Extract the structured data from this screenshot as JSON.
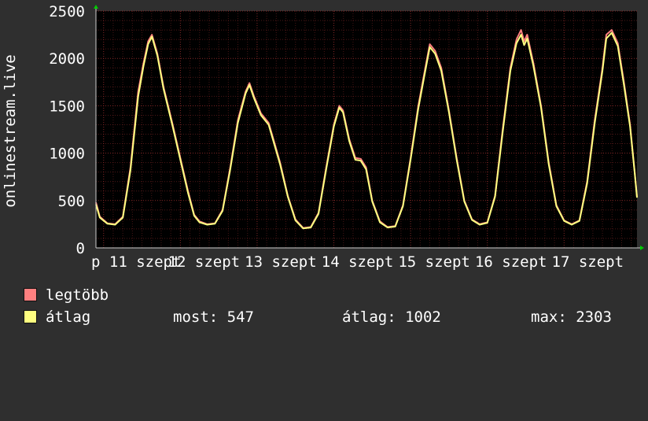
{
  "colors": {
    "background": "#2f2f2f",
    "plot_background": "#000000",
    "grid": "#8b2a2a",
    "text": "#ffffff",
    "max_series": "#ff8080",
    "avg_series": "#ffff80",
    "axis_arrow": "#00cc00"
  },
  "chart_data": {
    "type": "line",
    "ylabel": "onlinestream.live",
    "ylim": [
      0,
      2500
    ],
    "yticks": [
      0,
      500,
      1000,
      1500,
      2000,
      2500
    ],
    "x_tick_labels": [
      "p 11 szept",
      "12 szept",
      "13 szept",
      "14 szept",
      "15 szept",
      "16 szept",
      "17 szept"
    ],
    "x_day_range": [
      10.9,
      17.95
    ],
    "grid": true,
    "series": [
      {
        "name": "legtöbb",
        "color": "#ff8080",
        "points": [
          [
            10.9,
            480
          ],
          [
            10.95,
            330
          ],
          [
            11.05,
            260
          ],
          [
            11.15,
            250
          ],
          [
            11.25,
            330
          ],
          [
            11.35,
            850
          ],
          [
            11.45,
            1650
          ],
          [
            11.52,
            1950
          ],
          [
            11.58,
            2180
          ],
          [
            11.63,
            2250
          ],
          [
            11.7,
            2050
          ],
          [
            11.78,
            1700
          ],
          [
            11.9,
            1300
          ],
          [
            12.0,
            950
          ],
          [
            12.1,
            600
          ],
          [
            12.18,
            350
          ],
          [
            12.25,
            280
          ],
          [
            12.35,
            250
          ],
          [
            12.45,
            260
          ],
          [
            12.55,
            400
          ],
          [
            12.65,
            850
          ],
          [
            12.75,
            1350
          ],
          [
            12.85,
            1650
          ],
          [
            12.9,
            1740
          ],
          [
            12.96,
            1600
          ],
          [
            13.05,
            1420
          ],
          [
            13.15,
            1320
          ],
          [
            13.2,
            1180
          ],
          [
            13.3,
            900
          ],
          [
            13.4,
            550
          ],
          [
            13.5,
            300
          ],
          [
            13.6,
            210
          ],
          [
            13.7,
            220
          ],
          [
            13.8,
            370
          ],
          [
            13.9,
            850
          ],
          [
            14.0,
            1300
          ],
          [
            14.07,
            1500
          ],
          [
            14.12,
            1450
          ],
          [
            14.2,
            1150
          ],
          [
            14.28,
            950
          ],
          [
            14.35,
            940
          ],
          [
            14.42,
            850
          ],
          [
            14.5,
            500
          ],
          [
            14.6,
            280
          ],
          [
            14.7,
            220
          ],
          [
            14.8,
            230
          ],
          [
            14.9,
            450
          ],
          [
            15.0,
            950
          ],
          [
            15.1,
            1500
          ],
          [
            15.18,
            1850
          ],
          [
            15.25,
            2150
          ],
          [
            15.32,
            2080
          ],
          [
            15.4,
            1900
          ],
          [
            15.5,
            1450
          ],
          [
            15.6,
            950
          ],
          [
            15.7,
            500
          ],
          [
            15.8,
            300
          ],
          [
            15.9,
            250
          ],
          [
            16.0,
            270
          ],
          [
            16.1,
            550
          ],
          [
            16.2,
            1250
          ],
          [
            16.3,
            1900
          ],
          [
            16.38,
            2200
          ],
          [
            16.44,
            2300
          ],
          [
            16.48,
            2180
          ],
          [
            16.52,
            2250
          ],
          [
            16.6,
            1950
          ],
          [
            16.7,
            1500
          ],
          [
            16.8,
            900
          ],
          [
            16.9,
            450
          ],
          [
            17.0,
            290
          ],
          [
            17.1,
            250
          ],
          [
            17.2,
            290
          ],
          [
            17.3,
            700
          ],
          [
            17.4,
            1350
          ],
          [
            17.5,
            1900
          ],
          [
            17.55,
            2250
          ],
          [
            17.62,
            2300
          ],
          [
            17.7,
            2160
          ],
          [
            17.78,
            1750
          ],
          [
            17.86,
            1300
          ],
          [
            17.92,
            800
          ],
          [
            17.95,
            540
          ]
        ]
      },
      {
        "name": "átlag",
        "color": "#ffff80",
        "points": [
          [
            10.9,
            460
          ],
          [
            10.95,
            320
          ],
          [
            11.05,
            255
          ],
          [
            11.15,
            245
          ],
          [
            11.25,
            320
          ],
          [
            11.35,
            820
          ],
          [
            11.45,
            1600
          ],
          [
            11.52,
            1920
          ],
          [
            11.58,
            2150
          ],
          [
            11.63,
            2230
          ],
          [
            11.7,
            2030
          ],
          [
            11.78,
            1680
          ],
          [
            11.9,
            1280
          ],
          [
            12.0,
            930
          ],
          [
            12.1,
            580
          ],
          [
            12.18,
            340
          ],
          [
            12.25,
            270
          ],
          [
            12.35,
            245
          ],
          [
            12.45,
            255
          ],
          [
            12.55,
            390
          ],
          [
            12.65,
            830
          ],
          [
            12.75,
            1320
          ],
          [
            12.85,
            1630
          ],
          [
            12.9,
            1720
          ],
          [
            12.96,
            1580
          ],
          [
            13.05,
            1400
          ],
          [
            13.15,
            1300
          ],
          [
            13.2,
            1160
          ],
          [
            13.3,
            880
          ],
          [
            13.4,
            540
          ],
          [
            13.5,
            290
          ],
          [
            13.6,
            205
          ],
          [
            13.7,
            215
          ],
          [
            13.8,
            360
          ],
          [
            13.9,
            830
          ],
          [
            14.0,
            1280
          ],
          [
            14.07,
            1480
          ],
          [
            14.12,
            1430
          ],
          [
            14.2,
            1130
          ],
          [
            14.28,
            930
          ],
          [
            14.35,
            920
          ],
          [
            14.42,
            830
          ],
          [
            14.5,
            490
          ],
          [
            14.6,
            270
          ],
          [
            14.7,
            215
          ],
          [
            14.8,
            225
          ],
          [
            14.9,
            440
          ],
          [
            15.0,
            930
          ],
          [
            15.1,
            1470
          ],
          [
            15.18,
            1820
          ],
          [
            15.25,
            2120
          ],
          [
            15.32,
            2050
          ],
          [
            15.4,
            1870
          ],
          [
            15.5,
            1430
          ],
          [
            15.6,
            930
          ],
          [
            15.7,
            490
          ],
          [
            15.8,
            295
          ],
          [
            15.9,
            245
          ],
          [
            16.0,
            265
          ],
          [
            16.1,
            540
          ],
          [
            16.2,
            1220
          ],
          [
            16.3,
            1870
          ],
          [
            16.38,
            2160
          ],
          [
            16.44,
            2250
          ],
          [
            16.48,
            2140
          ],
          [
            16.52,
            2210
          ],
          [
            16.6,
            1920
          ],
          [
            16.7,
            1480
          ],
          [
            16.8,
            880
          ],
          [
            16.9,
            440
          ],
          [
            17.0,
            285
          ],
          [
            17.1,
            245
          ],
          [
            17.2,
            285
          ],
          [
            17.3,
            680
          ],
          [
            17.4,
            1320
          ],
          [
            17.5,
            1870
          ],
          [
            17.55,
            2210
          ],
          [
            17.62,
            2270
          ],
          [
            17.7,
            2130
          ],
          [
            17.78,
            1720
          ],
          [
            17.86,
            1280
          ],
          [
            17.92,
            790
          ],
          [
            17.95,
            530
          ]
        ]
      }
    ]
  },
  "legend": {
    "max_label": "legtöbb",
    "avg_label": "átlag"
  },
  "stats": {
    "now": "most: 547",
    "avg": "átlag: 1002",
    "max": "max: 2303"
  }
}
